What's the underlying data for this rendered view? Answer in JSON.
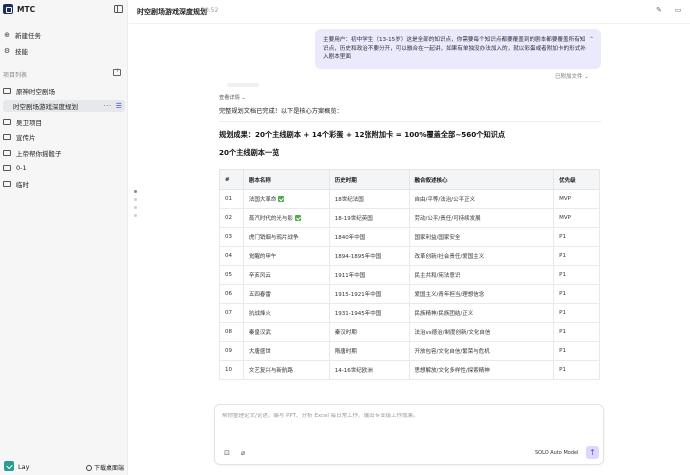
{
  "app": {
    "name": "MTC"
  },
  "sidebar": {
    "nav": [
      {
        "label": "新建任务",
        "icon": "plus-circle-icon"
      },
      {
        "label": "技能",
        "icon": "puzzle-icon"
      }
    ],
    "section_label": "项目列表",
    "projects": [
      {
        "label": "原神时空剧场",
        "active": false
      },
      {
        "label": "时空剧场游戏深度规划",
        "active": true
      },
      {
        "label": "吴卫项目",
        "active": false
      },
      {
        "label": "宣传片",
        "active": false
      },
      {
        "label": "上帝帮你摇骰子",
        "active": false
      },
      {
        "label": "0-1",
        "active": false
      },
      {
        "label": "临时",
        "active": false
      }
    ],
    "user": {
      "name": "Lay"
    },
    "download_label": "下载桌面端"
  },
  "header": {
    "title": "时空剧场游戏深度规划",
    "time": "20:52"
  },
  "chat": {
    "user_message": "主要用户：初中学生（13-15岁）这是全部的知识点，你需要每个知识点都要覆盖到的剧本都要覆盖所有知识点，历史和政治不要分开，可以融合在一起讲，如果有单独没办法加入的，就以彩蛋或者附加卡的形式补入剧本里面",
    "copied_label": "已附加文件",
    "expand_label": "查看详情",
    "done_text": "完整规划文档已完成！以下是核心方案概览：",
    "plan_heading": "规划成果：20个主线剧本 + 14个彩蛋 + 12张附加卡 = 100%覆盖全部~560个知识点",
    "list_heading": "20个主线剧本一览"
  },
  "table": {
    "headers": [
      "#",
      "剧本名称",
      "历史时期",
      "融合叙述核心",
      "优先级"
    ],
    "rows": [
      {
        "num": "01",
        "name": "法国大革命",
        "check": true,
        "period": "18世纪法国",
        "core": "自由/平等/法治/公平正义",
        "priority": "MVP"
      },
      {
        "num": "02",
        "name": "蒸汽时代的光与影",
        "check": true,
        "period": "18-19世纪英国",
        "core": "劳动/公平/责任/可持续发展",
        "priority": "MVP"
      },
      {
        "num": "03",
        "name": "虎门销烟与鸦片战争",
        "check": false,
        "period": "1840年中国",
        "core": "国家利益/国家安全",
        "priority": "P1"
      },
      {
        "num": "04",
        "name": "觉醒的甲午",
        "check": false,
        "period": "1894-1895年中国",
        "core": "改革创新/社会责任/爱国主义",
        "priority": "P1"
      },
      {
        "num": "05",
        "name": "辛亥风云",
        "check": false,
        "period": "1911年中国",
        "core": "民主共和/宪法意识",
        "priority": "P1"
      },
      {
        "num": "06",
        "name": "五四春雷",
        "check": false,
        "period": "1915-1921年中国",
        "core": "爱国主义/青年担当/理想信念",
        "priority": "P1"
      },
      {
        "num": "07",
        "name": "抗战烽火",
        "check": false,
        "period": "1931-1945年中国",
        "core": "民族精神/民族团结/正义",
        "priority": "P1"
      },
      {
        "num": "08",
        "name": "秦皇汉武",
        "check": false,
        "period": "秦汉时期",
        "core": "法治vs德治/制度创新/文化自信",
        "priority": "P1"
      },
      {
        "num": "09",
        "name": "大唐盛世",
        "check": false,
        "period": "隋唐时期",
        "core": "开放包容/文化自信/繁荣与危机",
        "priority": "P1"
      },
      {
        "num": "10",
        "name": "文艺复兴与新航路",
        "check": false,
        "period": "14-16世纪欧洲",
        "core": "思想解放/文化多样性/探索精神",
        "priority": "P1"
      }
    ]
  },
  "input": {
    "placeholder": "帮你整理论文/论述、编写 PPT、分析 Excel 每日常工作、输出专业级工作成果。",
    "model_label": "SOLO Auto Model"
  }
}
